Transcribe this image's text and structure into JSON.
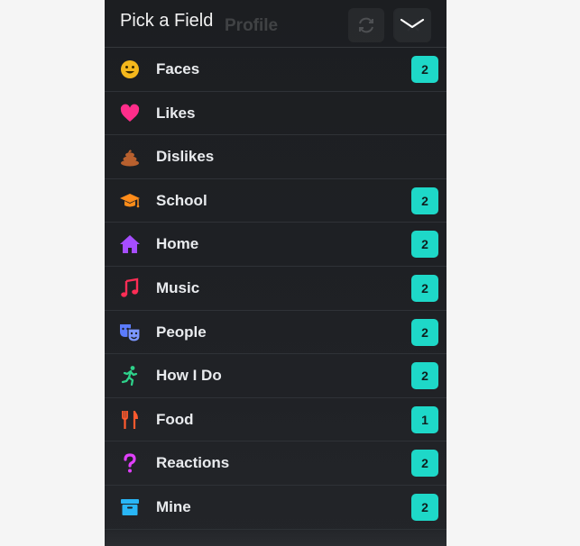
{
  "header": {
    "title": "Pick a Field",
    "background_title": "Profile"
  },
  "colors": {
    "badge": "#1ed8c8",
    "panel": "#1f2125"
  },
  "fields": [
    {
      "label": "Faces",
      "icon": "smiley-face-icon",
      "color": "#f5b81c",
      "count": "2"
    },
    {
      "label": "Likes",
      "icon": "heart-icon",
      "color": "#ff2d8a",
      "count": ""
    },
    {
      "label": "Dislikes",
      "icon": "poop-icon",
      "color": "#b8602e",
      "count": ""
    },
    {
      "label": "School",
      "icon": "graduation-cap-icon",
      "color": "#ff8c1a",
      "count": "2"
    },
    {
      "label": "Home",
      "icon": "house-icon",
      "color": "#a64dff",
      "count": "2"
    },
    {
      "label": "Music",
      "icon": "music-note-icon",
      "color": "#ff2d55",
      "count": "2"
    },
    {
      "label": "People",
      "icon": "theater-masks-icon",
      "color": "#5b7cff",
      "count": "2"
    },
    {
      "label": "How I Do",
      "icon": "running-person-icon",
      "color": "#2ed18a",
      "count": "2"
    },
    {
      "label": "Food",
      "icon": "fork-knife-icon",
      "color": "#ff5a2e",
      "count": "1"
    },
    {
      "label": "Reactions",
      "icon": "question-mark-icon",
      "color": "#e040fb",
      "count": "2"
    },
    {
      "label": "Mine",
      "icon": "archive-box-icon",
      "color": "#29b6f6",
      "count": "2"
    }
  ]
}
